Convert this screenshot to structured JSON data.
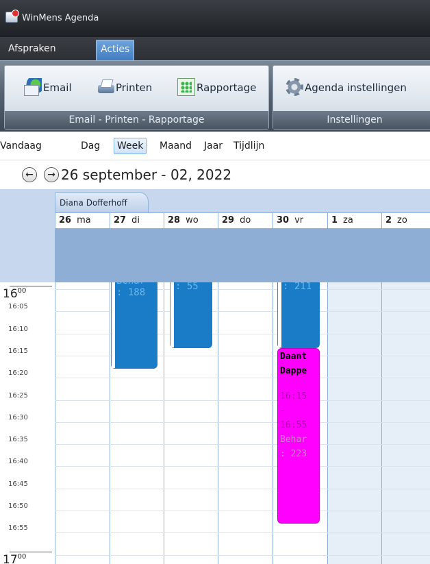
{
  "window": {
    "title": "WinMens Agenda"
  },
  "ribbon": {
    "tabs": [
      "Afspraken",
      "Acties"
    ],
    "groups": [
      {
        "caption": "Email - Printen - Rapportage",
        "buttons": [
          "Email",
          "Printen",
          "Rapportage"
        ]
      },
      {
        "caption": "Instellingen",
        "buttons": [
          "Agenda instellingen"
        ]
      }
    ]
  },
  "views": [
    "Vandaag",
    "Dag",
    "Week",
    "Maand",
    "Jaar",
    "Tijdlijn"
  ],
  "selected_view": "Week",
  "date_range": "26 september  - 02, 2022",
  "person": "Diana Dofferhoff",
  "days": [
    {
      "num": "26",
      "name": "ma"
    },
    {
      "num": "27",
      "name": "di"
    },
    {
      "num": "28",
      "name": "wo"
    },
    {
      "num": "29",
      "name": "do"
    },
    {
      "num": "30",
      "name": "vr"
    },
    {
      "num": "1",
      "name": "za"
    },
    {
      "num": "2",
      "name": "zo"
    }
  ],
  "hours": [
    "16",
    "17"
  ],
  "hour_suffix": "00",
  "minute_labels": [
    "16:05",
    "16:10",
    "16:15",
    "16:20",
    "16:25",
    "16:30",
    "16:35",
    "16:40",
    "16:45",
    "16:50",
    "16:55"
  ],
  "appointments": [
    {
      "day": "27 di",
      "color": "#1a7cc7",
      "lines": [
        "Behar",
        ": 188"
      ]
    },
    {
      "day": "28 wo",
      "color": "#1a7cc7",
      "lines": [
        ": 55"
      ]
    },
    {
      "day": "30 vr",
      "color": "#1a7cc7",
      "lines": [
        ": 211"
      ]
    },
    {
      "day": "30 vr",
      "color": "#ff00ff",
      "lines": [
        "Daant",
        "Dappe",
        "16:15",
        "-",
        "16:55",
        "Behar",
        ": 223"
      ]
    }
  ]
}
